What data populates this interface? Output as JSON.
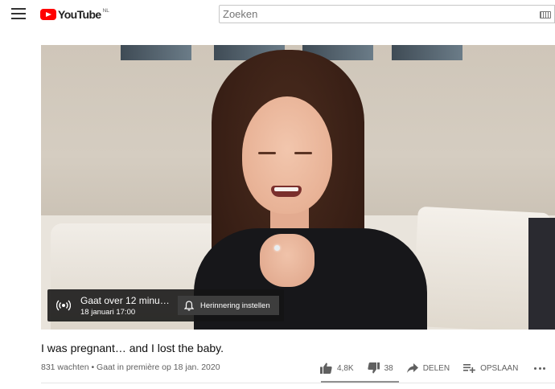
{
  "masthead": {
    "logo_text": "YouTube",
    "region": "NL",
    "search_placeholder": "Zoeken"
  },
  "premiere": {
    "title": "Gaat over 12 minute...",
    "date": "18 januari 17:00",
    "reminder_label": "Herinnering instellen"
  },
  "video": {
    "title": "I was pregnant… and I lost the baby.",
    "meta": "831 wachten • Gaat in première op 18 jan. 2020"
  },
  "actions": {
    "likes": "4,8K",
    "dislikes": "38",
    "share_label": "DELEN",
    "save_label": "OPSLAAN"
  },
  "colors": {
    "brand": "#ff0000",
    "meta_text": "#606060",
    "overlay_bg": "#141414"
  },
  "icons": [
    "menu-icon",
    "youtube-logo-icon",
    "keyboard-icon",
    "live-broadcast-icon",
    "bell-icon",
    "thumbs-up-icon",
    "thumbs-down-icon",
    "share-icon",
    "playlist-add-icon",
    "more-icon"
  ]
}
